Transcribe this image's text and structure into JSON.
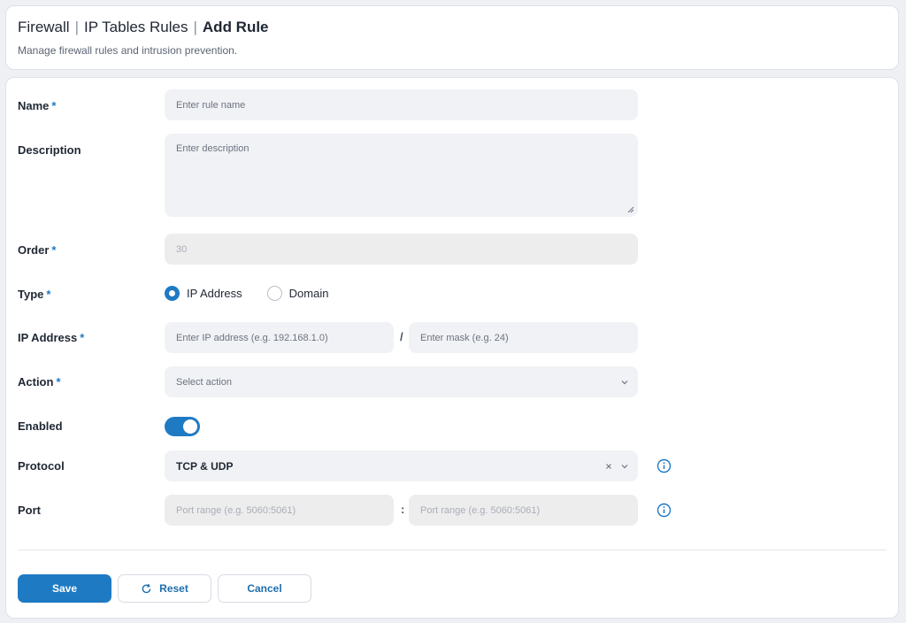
{
  "header": {
    "breadcrumb": [
      "Firewall",
      "IP Tables Rules",
      "Add Rule"
    ],
    "separator": "|",
    "subtitle": "Manage firewall rules and intrusion prevention."
  },
  "required_marker": "*",
  "form": {
    "name": {
      "label": "Name",
      "placeholder": "Enter rule name",
      "required": true
    },
    "description": {
      "label": "Description",
      "placeholder": "Enter description",
      "required": false
    },
    "order": {
      "label": "Order",
      "value": "30",
      "required": true,
      "disabled": true
    },
    "type": {
      "label": "Type",
      "required": true,
      "options": [
        "IP Address",
        "Domain"
      ],
      "selected": "IP Address"
    },
    "ip_address": {
      "label": "IP Address",
      "required": true,
      "address_placeholder": "Enter IP address (e.g. 192.168.1.0)",
      "separator": "/",
      "mask_placeholder": "Enter mask (e.g. 24)"
    },
    "action": {
      "label": "Action",
      "required": true,
      "placeholder": "Select action"
    },
    "enabled": {
      "label": "Enabled",
      "on": true
    },
    "protocol": {
      "label": "Protocol",
      "value": "TCP & UDP"
    },
    "port": {
      "label": "Port",
      "from_placeholder": "Port range (e.g. 5060:5061)",
      "separator": ":",
      "to_placeholder": "Port range (e.g. 5060:5061)",
      "disabled": true
    }
  },
  "buttons": {
    "save": "Save",
    "reset": "Reset",
    "cancel": "Cancel"
  },
  "colors": {
    "accent": "#1f7ac4",
    "background": "#eef0f4",
    "field": "#f1f2f5"
  },
  "icons": {
    "protocol_info": "info-icon",
    "port_info": "info-icon",
    "reset": "refresh-icon",
    "dropdown": "chevron-down-icon",
    "clear": "close-icon"
  }
}
